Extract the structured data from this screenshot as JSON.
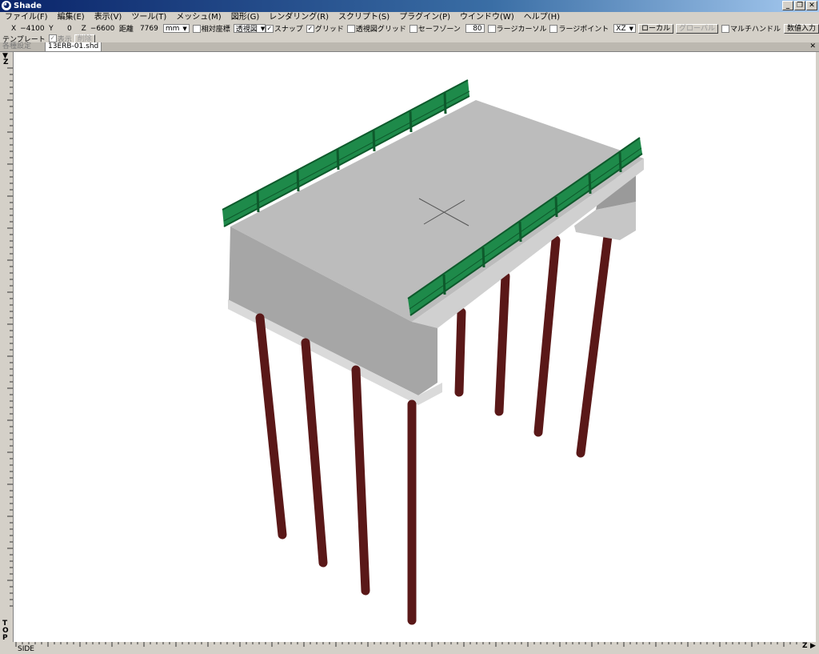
{
  "window": {
    "title": "Shade"
  },
  "window_buttons": [
    "_",
    "❐",
    "✕"
  ],
  "menu": [
    "ファイル(F)",
    "編集(E)",
    "表示(V)",
    "ツール(T)",
    "メッシュ(M)",
    "図形(G)",
    "レンダリング(R)",
    "スクリプト(S)",
    "プラグイン(P)",
    "ウインドウ(W)",
    "ヘルプ(H)"
  ],
  "coords": {
    "x_label": "X",
    "x_value": "−4100",
    "y_label": "Y",
    "y_value": "0",
    "z_label": "Z",
    "z_value": "−6600",
    "distance_label": "距離",
    "distance_value": "7769"
  },
  "toolbar": {
    "unit": "mm",
    "relative_coords": "相対座標",
    "view_mode": "透視図",
    "snap": "スナップ",
    "grid": "グリッド",
    "perspective_grid": "透視図グリッド",
    "safe_zone": "セーフゾーン",
    "safe_zone_value": "80",
    "large_cursor": "ラージカーソル",
    "large_point": "ラージポイント",
    "plane": "XZ",
    "local": "ローカル",
    "global": "グローバル",
    "multi_handle": "マルチハンドル",
    "numeric_input": "数値入力"
  },
  "toolbar_states": {
    "relative_coords": false,
    "snap": true,
    "grid": true,
    "perspective_grid": false,
    "safe_zone": false,
    "large_cursor": false,
    "large_point": false,
    "multi_handle": false
  },
  "template": {
    "label": "テンプレート",
    "show": "表示",
    "delete": "削除",
    "show_checked": true
  },
  "tabs": {
    "inactive": "各種設定",
    "active": "13ERB-01.shd",
    "close": "✕"
  },
  "rulers": {
    "top_axis": "Z",
    "side_axis_vertical": "TOP",
    "bottom_left": "SIDE",
    "bottom_right_axis": "Z",
    "top_marker": "▼",
    "bottom_marker": "▶"
  },
  "colors": {
    "deck_top": "#bcbcbc",
    "deck_side": "#a8a8a8",
    "railing": "#1e8a4a",
    "railing_dark": "#0e5a2c",
    "pile": "#5a1818",
    "titlebar": "#0a246a"
  },
  "icons": {
    "app": "shade-app-icon",
    "crosshair": "center-crosshair-icon"
  }
}
